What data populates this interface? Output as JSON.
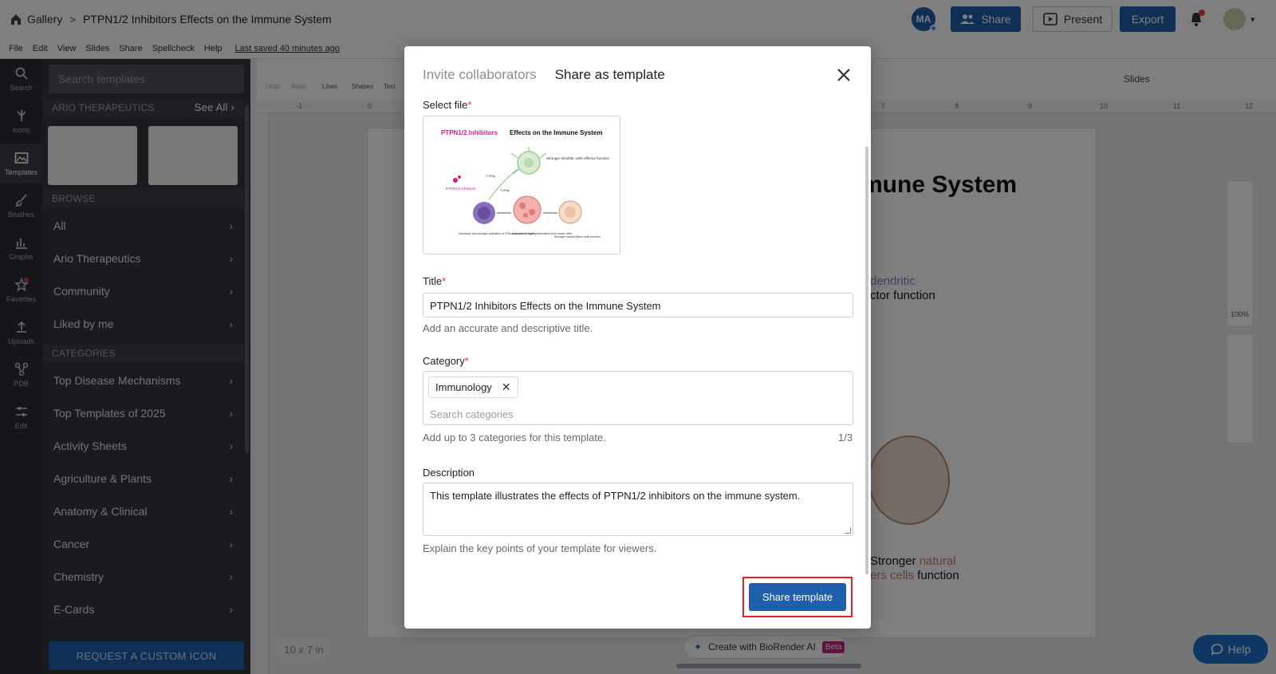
{
  "header": {
    "breadcrumb_root": "Gallery",
    "breadcrumb_sep": ">",
    "doc_title": "PTPN1/2 Inhibitors Effects on the Immune System",
    "avatar_initials": "MA",
    "share_label": "Share",
    "present_label": "Present",
    "export_label": "Export"
  },
  "menu": {
    "items": [
      "File",
      "Edit",
      "View",
      "Slides",
      "Share",
      "Spellcheck",
      "Help"
    ],
    "last_saved": "Last saved 40 minutes ago"
  },
  "rail": [
    {
      "label": "Search",
      "icon": "search-icon"
    },
    {
      "label": "Icons",
      "icon": "icons-icon"
    },
    {
      "label": "Templates",
      "icon": "templates-icon"
    },
    {
      "label": "Brushes",
      "icon": "brush-icon"
    },
    {
      "label": "Graphs",
      "icon": "graphs-icon"
    },
    {
      "label": "Favorites",
      "icon": "star-icon"
    },
    {
      "label": "Uploads",
      "icon": "upload-icon"
    },
    {
      "label": "PDB",
      "icon": "pdb-icon"
    },
    {
      "label": "Edit",
      "icon": "sliders-icon"
    }
  ],
  "panel": {
    "search_placeholder": "Search templates",
    "org_heading": "ARIO THERAPEUTICS",
    "see_all": "See All",
    "browse_heading": "BROWSE",
    "browse_items": [
      "All",
      "Ario Therapeutics",
      "Community",
      "Liked by me"
    ],
    "categories_heading": "CATEGORIES",
    "category_items": [
      "Top Disease Mechanisms",
      "Top Templates of 2025",
      "Activity Sheets",
      "Agriculture & Plants",
      "Anatomy & Clinical",
      "Cancer",
      "Chemistry",
      "E-Cards"
    ],
    "request_button": "REQUEST A CUSTOM ICON"
  },
  "canvas": {
    "slide_title_partial": "mune System",
    "text_dendritic": "dendritic",
    "text_effector": "ctor function",
    "text_stronger_a": "Stronger ",
    "text_natural": "natural",
    "text_killers": "ers cells",
    "text_function": " function",
    "size_tag": "10 x 7 in",
    "ai_button": "Create with BioRender AI",
    "ai_badge": "Beta",
    "help_button": "Help",
    "slides_label": "Slides",
    "zoom_level": "100%",
    "toolbar": [
      "Undo",
      "Redo",
      "Lines",
      "Shapes",
      "Text"
    ],
    "ruler_ticks": [
      "-1",
      "0",
      "7",
      "8",
      "9",
      "10",
      "11",
      "12"
    ]
  },
  "modal": {
    "tab_invite": "Invite collaborators",
    "tab_template": "Share as template",
    "select_file_label": "Select file",
    "required_mark": "*",
    "preview": {
      "title_pink": "PTPN1/2 Inhibitors",
      "title_rest": " Effects on the Immune System",
      "caption_left": "Increased and stronger activation of IFNs response in T cells",
      "caption_mid": "Increased antigen presentation from tumor cells",
      "caption_right": "Stronger natural killers cells function",
      "label_top": "Stronger dendritic cells effector function",
      "label_inhib": "PTPN1/2 inhibitors",
      "label_ifn1": "T-IFNy",
      "label_ifn2": "T-IFNy"
    },
    "title_label": "Title",
    "title_value": "PTPN1/2 Inhibitors Effects on the Immune System",
    "title_hint": "Add an accurate and descriptive title.",
    "category_label": "Category",
    "category_chip": "Immunology",
    "category_search_placeholder": "Search categories",
    "category_hint": "Add up to 3 categories for this template.",
    "category_count": "1/3",
    "description_label": "Description",
    "description_value": "This template illustrates the effects of PTPN1/2 inhibitors on the immune system.",
    "description_hint": "Explain the key points of your template for viewers.",
    "submit_label": "Share template"
  },
  "colors": {
    "brand_blue": "#1f5fad",
    "highlight_red": "#e02424",
    "required_red": "#d43d3d",
    "preview_pink": "#d61f8a"
  }
}
